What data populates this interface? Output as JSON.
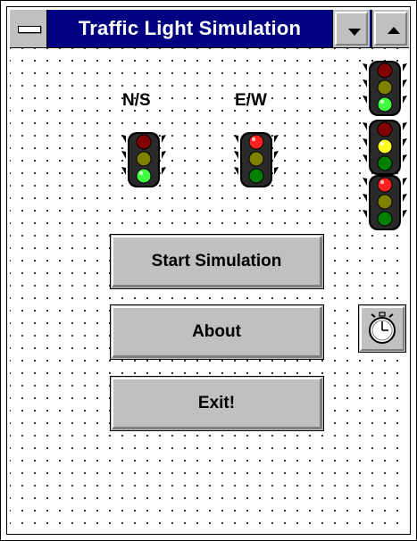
{
  "window": {
    "title": "Traffic Light Simulation"
  },
  "labels": {
    "north_south": "N/S",
    "east_west": "E/W"
  },
  "lights": {
    "ns": "green",
    "ew": "red",
    "palette": [
      "green",
      "yellow",
      "red"
    ]
  },
  "buttons": {
    "start": "Start Simulation",
    "about": "About",
    "exit": "Exit!"
  },
  "icons": {
    "timer": "stopwatch-icon",
    "system_menu": "system-menu-icon",
    "minimize": "minimize-arrow-icon",
    "maximize": "maximize-arrow-icon"
  },
  "colors": {
    "titlebar": "#000080",
    "button_face": "#c0c0c0",
    "red_on": "#ff2020",
    "red_off": "#800000",
    "yellow_on": "#ffff20",
    "yellow_off": "#808000",
    "green_on": "#40ff40",
    "green_off": "#008000"
  }
}
